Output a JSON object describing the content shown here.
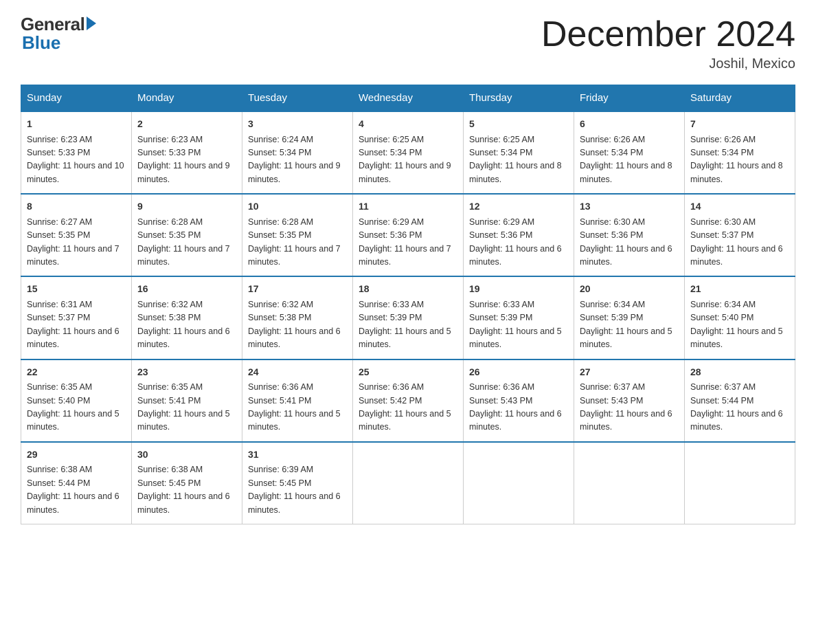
{
  "header": {
    "logo_general": "General",
    "logo_blue": "Blue",
    "title": "December 2024",
    "location": "Joshil, Mexico"
  },
  "weekdays": [
    "Sunday",
    "Monday",
    "Tuesday",
    "Wednesday",
    "Thursday",
    "Friday",
    "Saturday"
  ],
  "weeks": [
    [
      {
        "day": "1",
        "sunrise": "6:23 AM",
        "sunset": "5:33 PM",
        "daylight": "11 hours and 10 minutes."
      },
      {
        "day": "2",
        "sunrise": "6:23 AM",
        "sunset": "5:33 PM",
        "daylight": "11 hours and 9 minutes."
      },
      {
        "day": "3",
        "sunrise": "6:24 AM",
        "sunset": "5:34 PM",
        "daylight": "11 hours and 9 minutes."
      },
      {
        "day": "4",
        "sunrise": "6:25 AM",
        "sunset": "5:34 PM",
        "daylight": "11 hours and 9 minutes."
      },
      {
        "day": "5",
        "sunrise": "6:25 AM",
        "sunset": "5:34 PM",
        "daylight": "11 hours and 8 minutes."
      },
      {
        "day": "6",
        "sunrise": "6:26 AM",
        "sunset": "5:34 PM",
        "daylight": "11 hours and 8 minutes."
      },
      {
        "day": "7",
        "sunrise": "6:26 AM",
        "sunset": "5:34 PM",
        "daylight": "11 hours and 8 minutes."
      }
    ],
    [
      {
        "day": "8",
        "sunrise": "6:27 AM",
        "sunset": "5:35 PM",
        "daylight": "11 hours and 7 minutes."
      },
      {
        "day": "9",
        "sunrise": "6:28 AM",
        "sunset": "5:35 PM",
        "daylight": "11 hours and 7 minutes."
      },
      {
        "day": "10",
        "sunrise": "6:28 AM",
        "sunset": "5:35 PM",
        "daylight": "11 hours and 7 minutes."
      },
      {
        "day": "11",
        "sunrise": "6:29 AM",
        "sunset": "5:36 PM",
        "daylight": "11 hours and 7 minutes."
      },
      {
        "day": "12",
        "sunrise": "6:29 AM",
        "sunset": "5:36 PM",
        "daylight": "11 hours and 6 minutes."
      },
      {
        "day": "13",
        "sunrise": "6:30 AM",
        "sunset": "5:36 PM",
        "daylight": "11 hours and 6 minutes."
      },
      {
        "day": "14",
        "sunrise": "6:30 AM",
        "sunset": "5:37 PM",
        "daylight": "11 hours and 6 minutes."
      }
    ],
    [
      {
        "day": "15",
        "sunrise": "6:31 AM",
        "sunset": "5:37 PM",
        "daylight": "11 hours and 6 minutes."
      },
      {
        "day": "16",
        "sunrise": "6:32 AM",
        "sunset": "5:38 PM",
        "daylight": "11 hours and 6 minutes."
      },
      {
        "day": "17",
        "sunrise": "6:32 AM",
        "sunset": "5:38 PM",
        "daylight": "11 hours and 6 minutes."
      },
      {
        "day": "18",
        "sunrise": "6:33 AM",
        "sunset": "5:39 PM",
        "daylight": "11 hours and 5 minutes."
      },
      {
        "day": "19",
        "sunrise": "6:33 AM",
        "sunset": "5:39 PM",
        "daylight": "11 hours and 5 minutes."
      },
      {
        "day": "20",
        "sunrise": "6:34 AM",
        "sunset": "5:39 PM",
        "daylight": "11 hours and 5 minutes."
      },
      {
        "day": "21",
        "sunrise": "6:34 AM",
        "sunset": "5:40 PM",
        "daylight": "11 hours and 5 minutes."
      }
    ],
    [
      {
        "day": "22",
        "sunrise": "6:35 AM",
        "sunset": "5:40 PM",
        "daylight": "11 hours and 5 minutes."
      },
      {
        "day": "23",
        "sunrise": "6:35 AM",
        "sunset": "5:41 PM",
        "daylight": "11 hours and 5 minutes."
      },
      {
        "day": "24",
        "sunrise": "6:36 AM",
        "sunset": "5:41 PM",
        "daylight": "11 hours and 5 minutes."
      },
      {
        "day": "25",
        "sunrise": "6:36 AM",
        "sunset": "5:42 PM",
        "daylight": "11 hours and 5 minutes."
      },
      {
        "day": "26",
        "sunrise": "6:36 AM",
        "sunset": "5:43 PM",
        "daylight": "11 hours and 6 minutes."
      },
      {
        "day": "27",
        "sunrise": "6:37 AM",
        "sunset": "5:43 PM",
        "daylight": "11 hours and 6 minutes."
      },
      {
        "day": "28",
        "sunrise": "6:37 AM",
        "sunset": "5:44 PM",
        "daylight": "11 hours and 6 minutes."
      }
    ],
    [
      {
        "day": "29",
        "sunrise": "6:38 AM",
        "sunset": "5:44 PM",
        "daylight": "11 hours and 6 minutes."
      },
      {
        "day": "30",
        "sunrise": "6:38 AM",
        "sunset": "5:45 PM",
        "daylight": "11 hours and 6 minutes."
      },
      {
        "day": "31",
        "sunrise": "6:39 AM",
        "sunset": "5:45 PM",
        "daylight": "11 hours and 6 minutes."
      },
      null,
      null,
      null,
      null
    ]
  ]
}
